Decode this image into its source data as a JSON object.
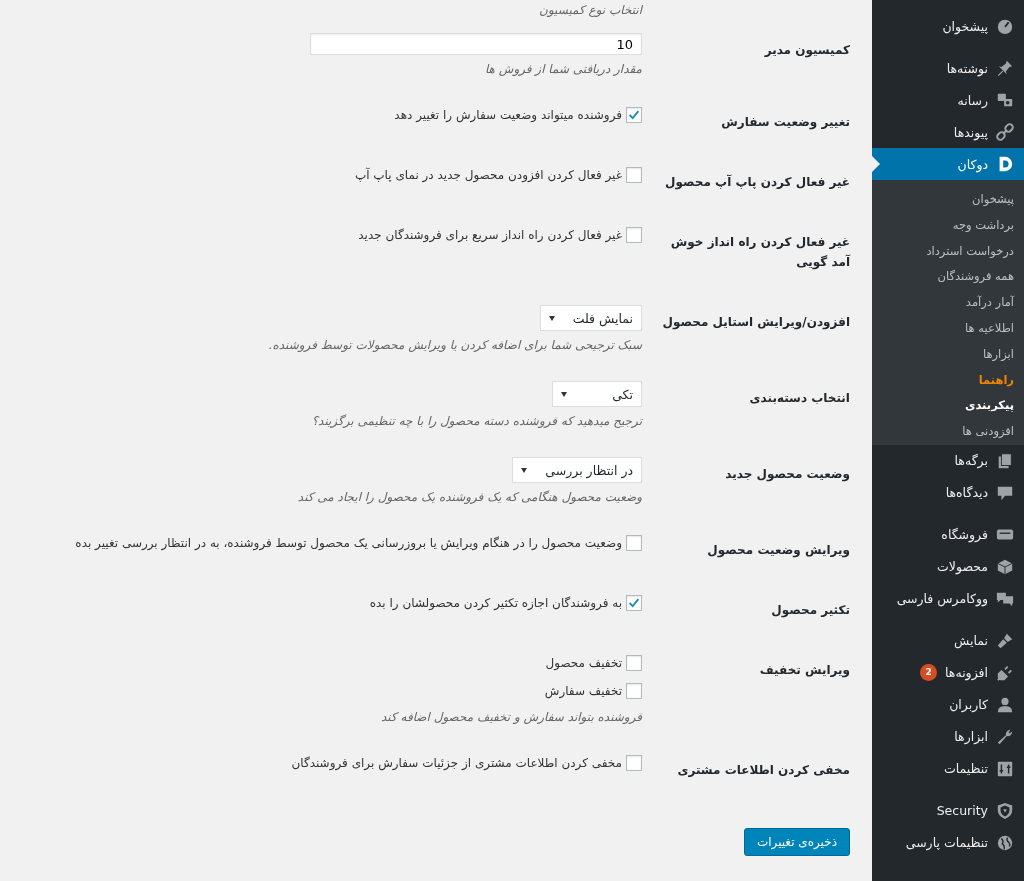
{
  "sidebar": {
    "groups": [
      {
        "items": [
          {
            "label": "پیشخوان",
            "selected": false
          }
        ]
      },
      {
        "items": [
          {
            "label": "نوشته‌ها",
            "selected": false
          },
          {
            "label": "رسانه",
            "selected": false
          },
          {
            "label": "پیوندها",
            "selected": false
          },
          {
            "label": "دوکان",
            "selected": true,
            "submenu": [
              {
                "label": "پیشخوان",
                "selected": false,
                "accent": false
              },
              {
                "label": "برداشت وجه",
                "selected": false,
                "accent": false
              },
              {
                "label": "درخواست استرداد",
                "selected": false,
                "accent": false
              },
              {
                "label": "همه فروشندگان",
                "selected": false,
                "accent": false
              },
              {
                "label": "آمار درآمد",
                "selected": false,
                "accent": false
              },
              {
                "label": "اطلاعیه ها",
                "selected": false,
                "accent": false
              },
              {
                "label": "ابزارها",
                "selected": false,
                "accent": false
              },
              {
                "label": "راهنما",
                "selected": false,
                "accent": true
              },
              {
                "label": "پیکربندی",
                "selected": true,
                "accent": false
              },
              {
                "label": "افزودنی ها",
                "selected": false,
                "accent": false
              }
            ]
          },
          {
            "label": "برگه‌ها",
            "selected": false
          },
          {
            "label": "دیدگاه‌ها",
            "selected": false
          }
        ]
      },
      {
        "items": [
          {
            "label": "فروشگاه",
            "selected": false
          },
          {
            "label": "محصولات",
            "selected": false
          },
          {
            "label": "ووکامرس فارسی",
            "selected": false
          }
        ]
      },
      {
        "items": [
          {
            "label": "نمایش",
            "selected": false
          },
          {
            "label": "افزونه‌ها",
            "selected": false,
            "badge": "2"
          },
          {
            "label": "کاربران",
            "selected": false
          },
          {
            "label": "ابزارها",
            "selected": false
          },
          {
            "label": "تنظیمات",
            "selected": false
          }
        ]
      },
      {
        "items": [
          {
            "label": "Security",
            "selected": false
          },
          {
            "label": "تنظیمات پارسی",
            "selected": false
          }
        ]
      }
    ]
  },
  "top_description": "انتخاب نوع کمیسیون",
  "settings": [
    {
      "kind": "text",
      "label": "کمیسیون مدیر",
      "value": "10",
      "description": "مقدار دریافتی شما از فروش ها"
    },
    {
      "kind": "checkbox",
      "label": "تغییر وضعیت سفارش",
      "options": [
        {
          "label": "فروشنده میتواند وضعیت سفارش را تغییر دهد",
          "checked": true
        }
      ]
    },
    {
      "kind": "checkbox",
      "label": "غیر فعال کردن پاپ آپ محصول",
      "options": [
        {
          "label": "غیر فعال کردن افزودن محصول جدید در نمای پاپ آپ",
          "checked": false
        }
      ]
    },
    {
      "kind": "checkbox",
      "label": "غیر فعال کردن راه انداز خوش آمد گویی",
      "options": [
        {
          "label": "غیر فعال کردن راه انداز سریع برای فروشندگان جدید",
          "checked": false
        }
      ]
    },
    {
      "kind": "select",
      "label": "افزودن/ویرایش استایل محصول",
      "value": "نمایش فلت",
      "description": "سبک ترجیحی شما برای اضافه کردن یا ویرایش محصولات توسط فروشنده."
    },
    {
      "kind": "select",
      "label": "انتخاب دسته‌بندی",
      "value": "تکی",
      "description": "ترجیح میدهید که فروشنده دسته محصول را با چه تنظیمی برگزیند؟"
    },
    {
      "kind": "select",
      "label": "وضعیت محصول جدید",
      "value": "در انتظار بررسی",
      "description": "وضعیت محصول هنگامی که یک فروشنده یک محصول را ایجاد می کند"
    },
    {
      "kind": "checkbox",
      "label": "ویرایش وضعیت محصول",
      "options": [
        {
          "label": "وضعیت محصول را در هنگام ویرایش یا بروزرسانی یک محصول توسط فروشنده، به در انتظار بررسی تغییر بده",
          "checked": false
        }
      ]
    },
    {
      "kind": "checkbox",
      "label": "تکثیر محصول",
      "options": [
        {
          "label": "به فروشندگان اجازه تکثیر کردن محصولشان را بده",
          "checked": true
        }
      ]
    },
    {
      "kind": "checkbox",
      "label": "ویرایش تخفیف",
      "options": [
        {
          "label": "تخفیف محصول",
          "checked": false
        },
        {
          "label": "تخفیف سفارش",
          "checked": false
        }
      ],
      "description": "فروشنده بتواند سفارش و تخفیف محصول اضافه کند"
    },
    {
      "kind": "checkbox",
      "label": "مخفی کردن اطلاعات مشتری",
      "options": [
        {
          "label": "مخفی کردن اطلاعات مشتری از جزئیات سفارش برای فروشندگان",
          "checked": false
        }
      ]
    }
  ],
  "save_button": "ذخیره‌ی تغییرات"
}
